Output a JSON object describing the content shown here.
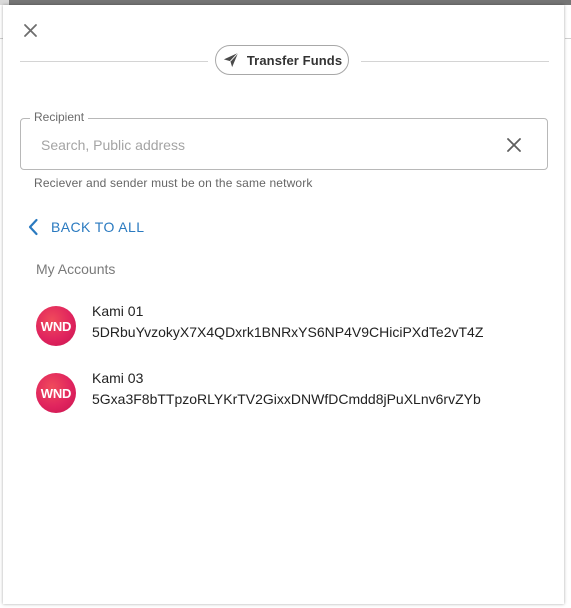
{
  "dialog": {
    "title": "Transfer Funds",
    "close_icon": "close-icon",
    "title_icon": "paper-plane-icon"
  },
  "recipient": {
    "label": "Recipient",
    "placeholder": "Search, Public address",
    "value": "",
    "clear_icon": "clear-icon",
    "helper": "Reciever and sender must be on the same network"
  },
  "back": {
    "label": "BACK TO ALL",
    "icon": "chevron-left-icon"
  },
  "accounts_section": {
    "title": "My Accounts",
    "items": [
      {
        "badge": "WND",
        "name": "Kami 01",
        "address": "5DRbuYvzokyX7X4QDxrk1BNRxYS6NP4V9CHiciPXdTe2vT4Z"
      },
      {
        "badge": "WND",
        "name": "Kami 03",
        "address": "5Gxa3F8bTTpzoRLYKrTV2GixxDNWfDCmdd8jPuXLnv6rvZYb"
      }
    ]
  },
  "colors": {
    "accent": "#2a7ac0",
    "badge": "#e0245e",
    "top_bar": "#757575"
  }
}
